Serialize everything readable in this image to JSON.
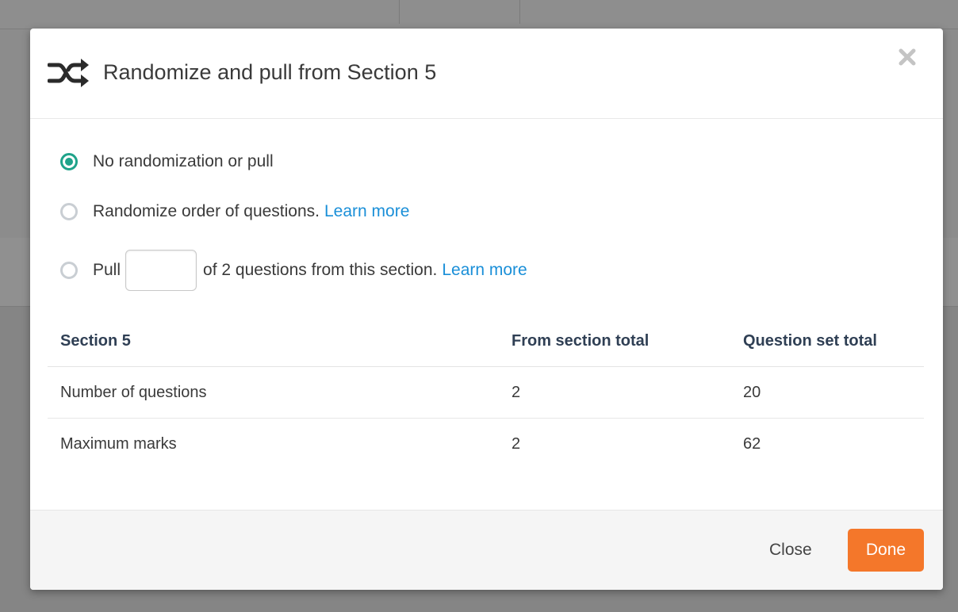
{
  "modal": {
    "title": "Randomize and pull from Section 5",
    "icon": "shuffle-icon",
    "close_icon": "close-icon"
  },
  "options": [
    {
      "label": "No randomization or pull",
      "selected": true
    },
    {
      "label": "Randomize order of questions.",
      "link": "Learn more",
      "selected": false
    },
    {
      "label_before": "Pull",
      "input_value": "",
      "label_after": "of 2 questions from this section.",
      "link": "Learn more",
      "selected": false
    }
  ],
  "table": {
    "headers": [
      "Section 5",
      "From section total",
      "Question set total"
    ],
    "rows": [
      [
        "Number of questions",
        "2",
        "20"
      ],
      [
        "Maximum marks",
        "2",
        "62"
      ]
    ]
  },
  "footer": {
    "close_label": "Close",
    "done_label": "Done"
  },
  "colors": {
    "accent": "#1fa38a",
    "link": "#1a8fd8",
    "primary_button": "#f4772a"
  }
}
